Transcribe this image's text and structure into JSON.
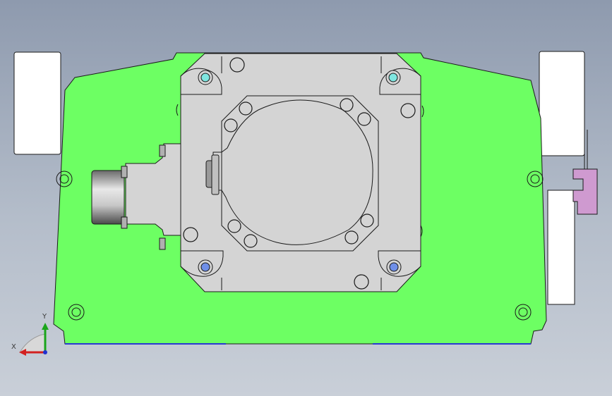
{
  "viewport": {
    "background_top": "#8e9aae",
    "background_bottom": "#c9cfd8"
  },
  "model": {
    "base_plate_color": "#6dff63",
    "motor_plate_color": "#d4d4d4",
    "block_color": "#ffffff",
    "bracket_color": "#cf9ad0",
    "hole_highlight_color": "#7fe6e0",
    "hole_blue_color": "#6f8fe8",
    "edge_color": "#1a1a1a"
  },
  "triad": {
    "x_label": "X",
    "y_label": "Y",
    "x_color": "#d22020",
    "y_color": "#1aa51a",
    "z_color": "#2030d0"
  }
}
